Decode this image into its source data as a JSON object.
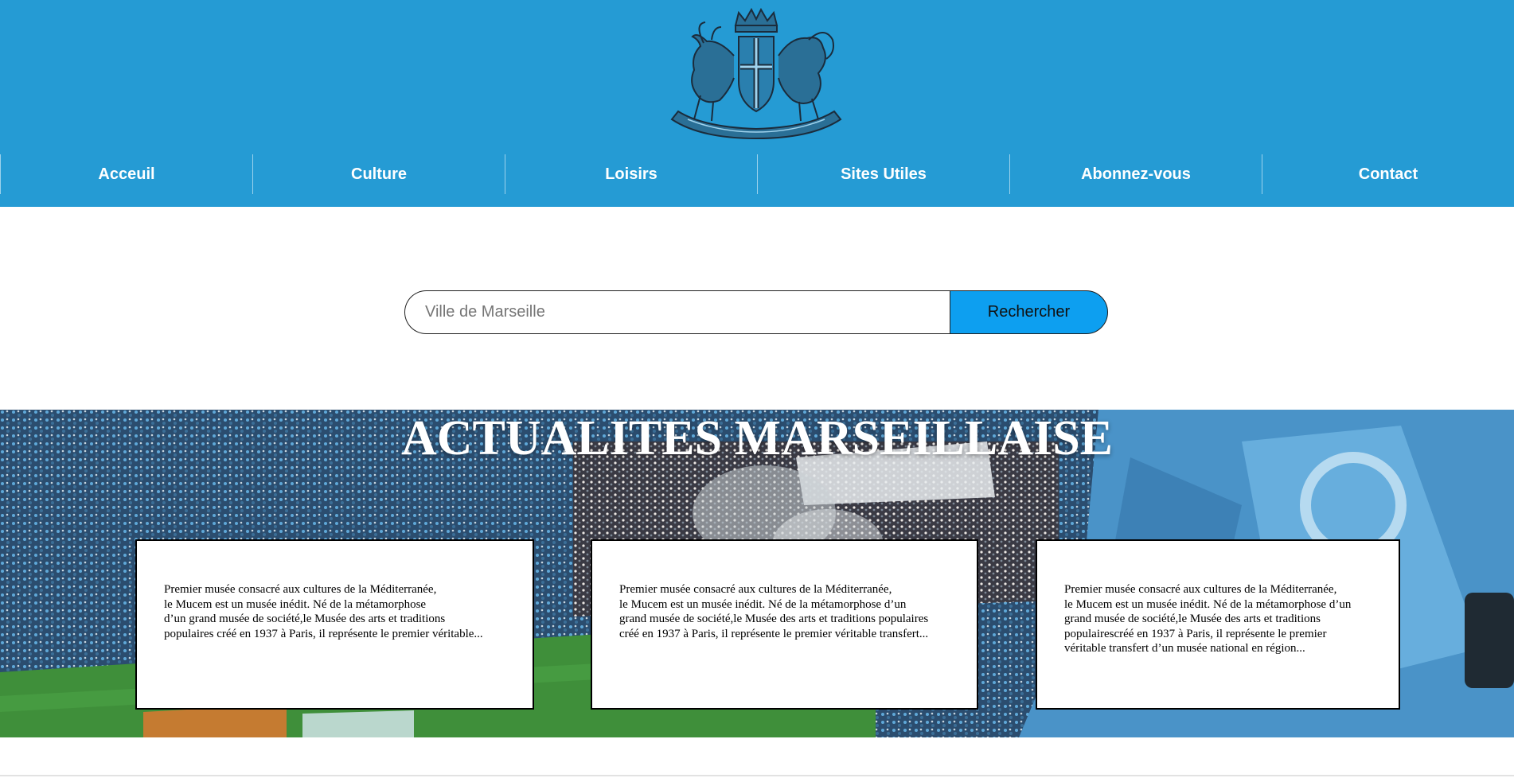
{
  "header": {
    "logo_icon": "marseille-coat-of-arms-icon",
    "background_color": "#259bd4"
  },
  "nav": {
    "items": [
      {
        "label": "Acceuil"
      },
      {
        "label": "Culture"
      },
      {
        "label": "Loisirs"
      },
      {
        "label": "Sites Utiles"
      },
      {
        "label": "Abonnez-vous"
      },
      {
        "label": "Contact"
      }
    ]
  },
  "search": {
    "placeholder": "Ville de Marseille",
    "value": "",
    "button_label": "Rechercher",
    "button_color": "#0d9ff0"
  },
  "news": {
    "title": "ACTUALITES MARSEILLAISE",
    "background_image": "stadium-crowd-image",
    "cards": [
      {
        "text": "Premier musée consacré aux cultures de la Méditerranée,\nle Mucem est un musée inédit. Né de la métamorphose\nd’un grand musée de société,le Musée des arts et traditions\npopulaires créé en 1937 à Paris, il représente le premier véritable..."
      },
      {
        "text": "Premier musée consacré aux cultures de la Méditerranée,\nle Mucem est un musée inédit. Né de la métamorphose d’un\ngrand musée de société,le Musée des arts et traditions populaires\ncréé en 1937 à Paris, il représente le premier véritable transfert..."
      },
      {
        "text": "Premier musée consacré aux cultures de la Méditerranée,\nle Mucem est un musée inédit. Né de la métamorphose d’un\ngrand musée de société,le Musée des arts et traditions\npopulairescréé en 1937 à Paris, il représente le premier\nvéritable transfert d’un musée national en région..."
      }
    ]
  }
}
